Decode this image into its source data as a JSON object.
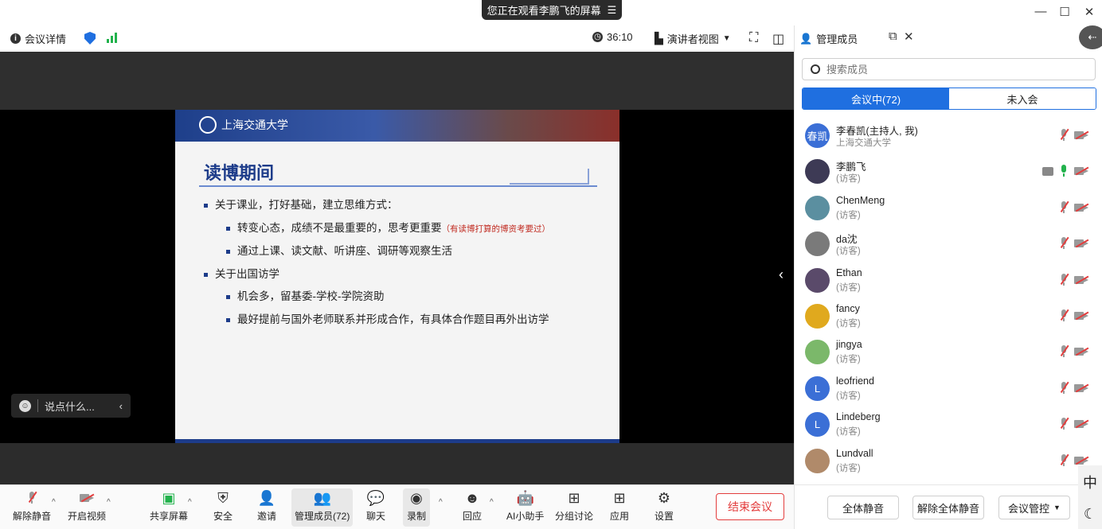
{
  "titlebar": {
    "sharing_banner": "您正在观看李鹏飞的屏幕",
    "banner_menu_icon": "menu-icon",
    "minimize": "—",
    "maximize": "☐",
    "close": "✕"
  },
  "infobar": {
    "meeting_details": "会议详情",
    "timer": "36:10",
    "view_mode": "演讲者视图"
  },
  "slide": {
    "university_logo_text": "上海交通大学",
    "title": "读博期间",
    "bullets": [
      {
        "level": 1,
        "text": "关于课业，打好基础，建立思维方式："
      },
      {
        "level": 2,
        "text": "转变心态，成绩不是最重要的，思考更重要",
        "note": "（有读博打算的博资考要过）"
      },
      {
        "level": 2,
        "text": "通过上课、读文献、听讲座、调研等观察生活"
      },
      {
        "level": 1,
        "text": "关于出国访学"
      },
      {
        "level": 2,
        "text": "机会多，留基委-学校-学院资助"
      },
      {
        "level": 2,
        "text": "最好提前与国外老师联系并形成合作，有具体合作题目再外出访学"
      }
    ]
  },
  "chat_input": {
    "placeholder": "说点什么..."
  },
  "toolbar": {
    "unmute": "解除静音",
    "start_video": "开启视频",
    "share_screen": "共享屏幕",
    "security": "安全",
    "invite": "邀请",
    "manage_members": "管理成员(72)",
    "chat": "聊天",
    "record": "录制",
    "react": "回应",
    "ai_assistant": "AI小助手",
    "breakout": "分组讨论",
    "apps": "应用",
    "settings": "设置",
    "end_meeting": "结束会议"
  },
  "panel": {
    "title": "管理成员",
    "search_placeholder": "搜索成员",
    "tab_in_meeting": "会议中(72)",
    "tab_not_joined": "未入会",
    "members": [
      {
        "name": "李春凯(主持人, 我)",
        "sub": "上海交通大学",
        "avatar_text": "春凯",
        "avatar_color": "#3b6fd6",
        "mic": "muted",
        "cam": "off",
        "sharing": false
      },
      {
        "name": "李鹏飞",
        "sub": "(访客)",
        "avatar_text": "",
        "avatar_color": "#3d3a55",
        "mic": "on",
        "cam": "off",
        "sharing": true
      },
      {
        "name": "ChenMeng",
        "sub": "(访客)",
        "avatar_text": "",
        "avatar_color": "#5b8fa0",
        "mic": "muted",
        "cam": "off",
        "sharing": false
      },
      {
        "name": "da沈",
        "sub": "(访客)",
        "avatar_text": "",
        "avatar_color": "#7a7a7a",
        "mic": "muted",
        "cam": "off",
        "sharing": false
      },
      {
        "name": "Ethan",
        "sub": "(访客)",
        "avatar_text": "",
        "avatar_color": "#5a4a6a",
        "mic": "muted",
        "cam": "off",
        "sharing": false
      },
      {
        "name": "fancy",
        "sub": "(访客)",
        "avatar_text": "",
        "avatar_color": "#e0a91e",
        "mic": "muted",
        "cam": "off",
        "sharing": false
      },
      {
        "name": "jingya",
        "sub": "(访客)",
        "avatar_text": "",
        "avatar_color": "#7bb86a",
        "mic": "muted",
        "cam": "off",
        "sharing": false
      },
      {
        "name": "leofriend",
        "sub": "(访客)",
        "avatar_text": "L",
        "avatar_color": "#3b6fd6",
        "mic": "muted",
        "cam": "off",
        "sharing": false
      },
      {
        "name": "Lindeberg",
        "sub": "(访客)",
        "avatar_text": "L",
        "avatar_color": "#3b6fd6",
        "mic": "muted",
        "cam": "off",
        "sharing": false
      },
      {
        "name": "Lundvall",
        "sub": "(访客)",
        "avatar_text": "",
        "avatar_color": "#b08a6a",
        "mic": "muted",
        "cam": "off",
        "sharing": false
      }
    ],
    "mute_all": "全体静音",
    "unmute_all": "解除全体静音",
    "meeting_control": "会议管控"
  },
  "ime": {
    "mode": "中",
    "moon_icon": "moon-icon"
  },
  "colors": {
    "accent": "#1f6fe0",
    "danger": "#e33d3d",
    "mic_on": "#22b24c"
  }
}
